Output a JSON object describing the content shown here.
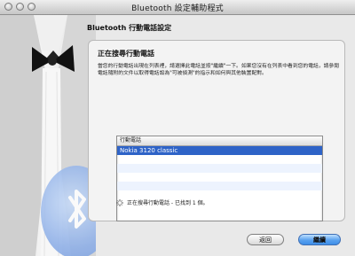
{
  "window": {
    "title": "Bluetooth 設定輔助程式"
  },
  "page": {
    "heading": "Bluetooth 行動電話設定",
    "panel_title": "正在搜尋行動電話",
    "description": "當您的行動電話出現在列表裡，請選擇此電話並按\"繼續\"一下。如果您沒有在列表中看到您的電話，請參閱電話隨附的文件以取得電話設為\"可被偵測\"的指示和如何與其他裝置配對。",
    "list": {
      "header": "行動電話",
      "items": [
        "Nokia 3120 classic"
      ],
      "selected_index": 0
    },
    "status_text": "正在搜尋行動電話 - 已找到 1 個。"
  },
  "buttons": {
    "back": "返回",
    "continue": "繼續"
  },
  "colors": {
    "selection": "#2e63c7",
    "accent_button": "#5aa2ef"
  }
}
